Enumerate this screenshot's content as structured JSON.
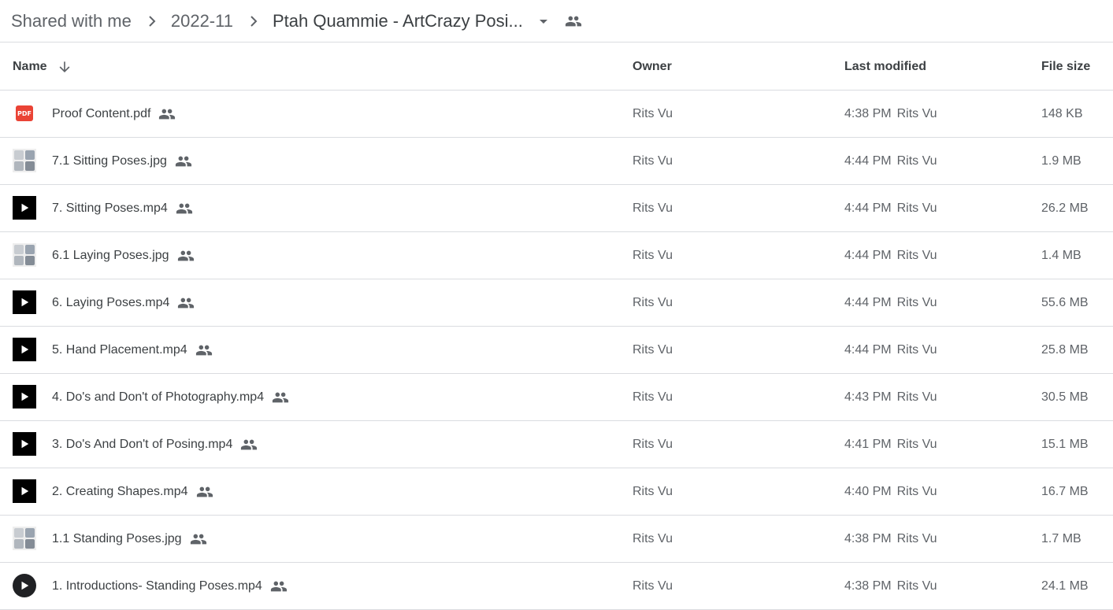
{
  "breadcrumb": {
    "items": [
      "Shared with me",
      "2022-11",
      "Ptah Quammie - ArtCrazy Posi..."
    ]
  },
  "header": {
    "name": "Name",
    "owner": "Owner",
    "last_modified": "Last modified",
    "file_size": "File size"
  },
  "files": [
    {
      "icon": "pdf-icon",
      "name": "Proof Content.pdf",
      "owner": "Rits Vu",
      "time": "4:38 PM",
      "modified_by": "Rits Vu",
      "size": "148 KB"
    },
    {
      "icon": "image-thumbnail",
      "name": "7.1 Sitting Poses.jpg",
      "owner": "Rits Vu",
      "time": "4:44 PM",
      "modified_by": "Rits Vu",
      "size": "1.9 MB"
    },
    {
      "icon": "video-icon",
      "name": "7. Sitting Poses.mp4",
      "owner": "Rits Vu",
      "time": "4:44 PM",
      "modified_by": "Rits Vu",
      "size": "26.2 MB"
    },
    {
      "icon": "image-thumbnail",
      "name": "6.1 Laying Poses.jpg",
      "owner": "Rits Vu",
      "time": "4:44 PM",
      "modified_by": "Rits Vu",
      "size": "1.4 MB"
    },
    {
      "icon": "video-icon",
      "name": "6. Laying Poses.mp4",
      "owner": "Rits Vu",
      "time": "4:44 PM",
      "modified_by": "Rits Vu",
      "size": "55.6 MB"
    },
    {
      "icon": "video-icon",
      "name": "5. Hand Placement.mp4",
      "owner": "Rits Vu",
      "time": "4:44 PM",
      "modified_by": "Rits Vu",
      "size": "25.8 MB"
    },
    {
      "icon": "video-icon",
      "name": "4. Do's and Don't of Photography.mp4",
      "owner": "Rits Vu",
      "time": "4:43 PM",
      "modified_by": "Rits Vu",
      "size": "30.5 MB"
    },
    {
      "icon": "video-icon",
      "name": "3. Do's And Don't of Posing.mp4",
      "owner": "Rits Vu",
      "time": "4:41 PM",
      "modified_by": "Rits Vu",
      "size": "15.1 MB"
    },
    {
      "icon": "video-icon",
      "name": "2. Creating Shapes.mp4",
      "owner": "Rits Vu",
      "time": "4:40 PM",
      "modified_by": "Rits Vu",
      "size": "16.7 MB"
    },
    {
      "icon": "image-thumbnail",
      "name": "1.1 Standing Poses.jpg",
      "owner": "Rits Vu",
      "time": "4:38 PM",
      "modified_by": "Rits Vu",
      "size": "1.7 MB"
    },
    {
      "icon": "video-thumbnail",
      "name": "1. Introductions- Standing Poses.mp4",
      "owner": "Rits Vu",
      "time": "4:38 PM",
      "modified_by": "Rits Vu",
      "size": "24.1 MB"
    }
  ],
  "icons": {
    "sort": "arrow-down-icon",
    "shared": "people-icon",
    "breadcrumb_separator": "chevron-right-icon",
    "dropdown": "caret-down-icon"
  },
  "colors": {
    "pdf": "#ea4335",
    "text": "#3c4043",
    "secondary_text": "#5f6368",
    "divider": "#dadce0"
  }
}
